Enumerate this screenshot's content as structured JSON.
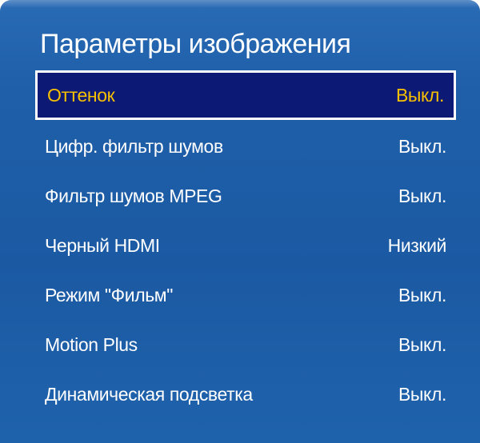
{
  "menu": {
    "title": "Параметры изображения",
    "items": [
      {
        "label": "Оттенок",
        "value": "Выкл."
      },
      {
        "label": "Цифр. фильтр шумов",
        "value": "Выкл."
      },
      {
        "label": "Фильтр шумов MPEG",
        "value": "Выкл."
      },
      {
        "label": "Черный HDMI",
        "value": "Низкий"
      },
      {
        "label": "Режим \"Фильм\"",
        "value": "Выкл."
      },
      {
        "label": "Motion Plus",
        "value": "Выкл."
      },
      {
        "label": "Динамическая подсветка",
        "value": "Выкл."
      }
    ],
    "selected_index": 0
  },
  "colors": {
    "panel_background": "#1d5ca6",
    "selected_background": "#0d1a75",
    "selected_text": "#f7c000",
    "text": "#ffffff"
  }
}
